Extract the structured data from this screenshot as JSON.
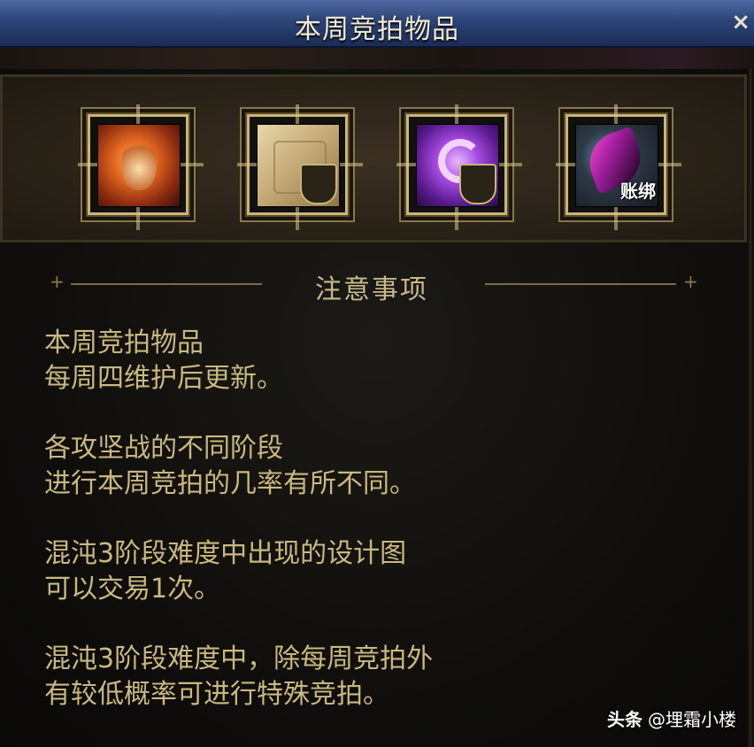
{
  "window": {
    "title": "本周竞拍物品",
    "close_label": "×"
  },
  "items": [
    {
      "icon": "fire-warrior-icon"
    },
    {
      "icon": "scroll-crest-icon"
    },
    {
      "icon": "purple-moon-crest-icon"
    },
    {
      "icon": "feather-account-icon",
      "tag": "账绑"
    }
  ],
  "notice": {
    "heading": "注意事项",
    "paragraphs": [
      [
        "本周竞拍物品",
        "每周四维护后更新。"
      ],
      [
        "各攻坚战的不同阶段",
        "进行本周竞拍的几率有所不同。"
      ],
      [
        "混沌3阶段难度中出现的设计图",
        "可以交易1次。"
      ],
      [
        "混沌3阶段难度中，除每周竞拍外",
        "有较低概率可进行特殊竞拍。"
      ]
    ]
  },
  "watermark": {
    "brand": "头条",
    "handle": "@埋霜小楼"
  }
}
